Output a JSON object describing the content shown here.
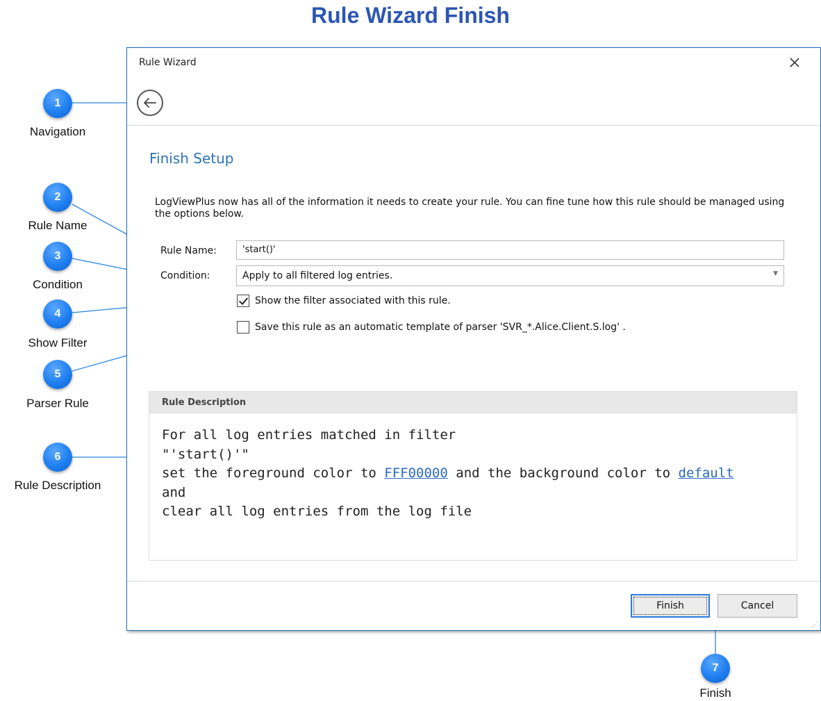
{
  "page_title": "Rule Wizard Finish",
  "dialog": {
    "title": "Rule Wizard",
    "close_icon": "close-icon",
    "back_icon": "back-arrow-icon",
    "section_title": "Finish Setup",
    "intro_text": "LogViewPlus now has all of the information it needs to create your rule.  You can fine tune how this rule should be managed using the options below.",
    "rule_name_label": "Rule Name:",
    "rule_name_value": "'start()'",
    "condition_label": "Condition:",
    "condition_value": "Apply to all filtered log entries.",
    "show_filter_label": "Show the filter associated with this rule.",
    "show_filter_checked": true,
    "save_template_label": "Save this rule as an automatic template of parser 'SVR_*.Alice.Client.S.log' .",
    "save_template_checked": false,
    "description": {
      "header": "Rule Description",
      "line1": "For all log entries matched in filter",
      "line2": "\"'start()'\"",
      "line3_before": "set the foreground color to ",
      "fg_color_link": "FFF00000",
      "line3_middle": " and the background color to ",
      "bg_color_link": "default",
      "line4": "and",
      "line5": "clear all log entries from the log file"
    },
    "finish_label": "Finish",
    "cancel_label": "Cancel"
  },
  "callouts": [
    {
      "number": "1",
      "label": "Navigation"
    },
    {
      "number": "2",
      "label": "Rule Name"
    },
    {
      "number": "3",
      "label": "Condition"
    },
    {
      "number": "4",
      "label": "Show Filter"
    },
    {
      "number": "5",
      "label": "Parser Rule"
    },
    {
      "number": "6",
      "label": "Rule Description"
    },
    {
      "number": "7",
      "label": "Finish"
    }
  ],
  "colors": {
    "title": "#2b56b4",
    "accent": "#2e74b5",
    "callout": "#1f7ff0",
    "link": "#2b68c4",
    "dialog_border": "#1f6bb8"
  }
}
